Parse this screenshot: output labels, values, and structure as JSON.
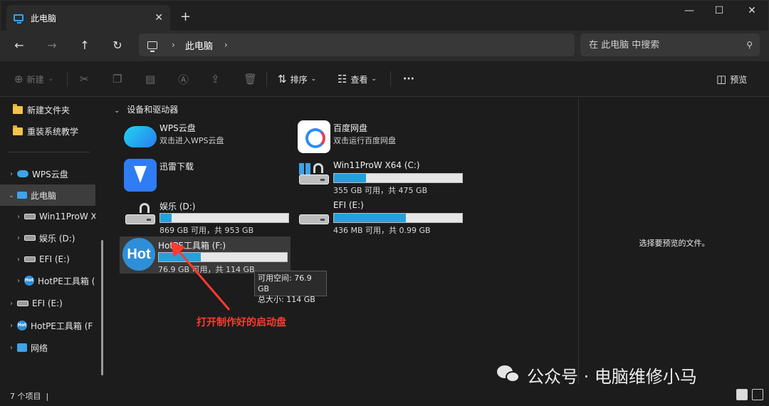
{
  "window": {
    "tab_title": "此电脑",
    "tab_close": "✕",
    "new_tab": "+",
    "minimize": "—",
    "maximize": "☐",
    "close": "✕"
  },
  "nav": {
    "back": "←",
    "forward": "→",
    "up": "↑",
    "refresh": "↻"
  },
  "address": {
    "crumbs": [
      "此电脑"
    ],
    "separator": "›"
  },
  "search": {
    "placeholder": "在 此电脑 中搜索"
  },
  "toolbar": {
    "new_label": "新建",
    "sort_label": "排序",
    "view_label": "查看",
    "more_label": "···",
    "preview_label": "预览"
  },
  "sidebar": {
    "items": [
      {
        "label": "新建文件夹",
        "icon": "folder-icon"
      },
      {
        "label": "重装系统教学",
        "icon": "folder-icon"
      },
      {
        "label": "WPS云盘",
        "icon": "cloud-icon"
      },
      {
        "label": "此电脑",
        "icon": "computer-icon",
        "selected": true
      },
      {
        "label": "Win11ProW X",
        "icon": "windows-drive-icon"
      },
      {
        "label": "娱乐 (D:)",
        "icon": "locked-drive-icon"
      },
      {
        "label": "EFI (E:)",
        "icon": "drive-icon"
      },
      {
        "label": "HotPE工具箱 (",
        "icon": "hotpe-icon"
      },
      {
        "label": "EFI (E:)",
        "icon": "drive-icon"
      },
      {
        "label": "HotPE工具箱 (F",
        "icon": "hotpe-icon"
      },
      {
        "label": "网络",
        "icon": "network-icon"
      }
    ]
  },
  "content": {
    "group_header": "设备和驱动器",
    "items": [
      {
        "name": "WPS云盘",
        "sub": "双击进入WPS云盘"
      },
      {
        "name": "百度网盘",
        "sub": "双击运行百度网盘"
      },
      {
        "name": "迅雷下载"
      },
      {
        "name": "Win11ProW X64 (C:)",
        "free": "355 GB 可用，共 475 GB",
        "used_fraction": 0.25
      },
      {
        "name": "娱乐 (D:)",
        "free": "869 GB 可用，共 953 GB",
        "used_fraction": 0.09
      },
      {
        "name": "EFI (E:)",
        "free": "436 MB 可用，共 0.99 GB",
        "used_fraction": 0.56
      },
      {
        "name": "HotPE工具箱 (F:)",
        "free": "76.9 GB 可用，共 114 GB",
        "used_fraction": 0.33
      }
    ],
    "hot_icon_text": "Hot",
    "tooltip": {
      "line1": "可用空间: 76.9 GB",
      "line2": "总大小: 114 GB"
    },
    "annotation": "打开制作好的启动盘",
    "annotation_color": "#ff3b2f"
  },
  "preview": {
    "empty_text": "选择要预览的文件。"
  },
  "status": {
    "count": "7 个项目",
    "divider": "|"
  },
  "watermark": {
    "text": "公众号 · 电脑维修小马"
  },
  "colors": {
    "accent": "#26a0da",
    "background": "#1c1c1c"
  }
}
